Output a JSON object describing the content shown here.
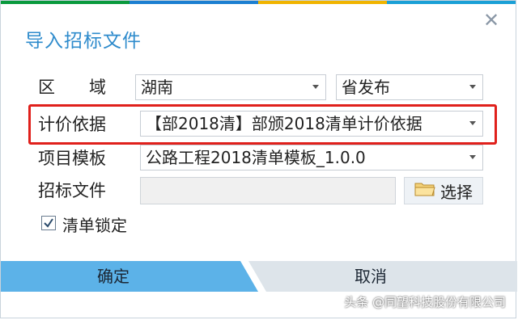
{
  "dialog": {
    "title": "导入招标文件"
  },
  "colors": {
    "top_bar": [
      "#0a9a3d",
      "#1c7fd1",
      "#f0b400",
      "#1aa0d6"
    ],
    "accent": "#2e8bcc",
    "ok_button": "#5cb2e8",
    "highlight": "#e0201b"
  },
  "form": {
    "region": {
      "label": "区　　域",
      "value": "湖南",
      "publisher": "省发布"
    },
    "pricing_basis": {
      "label": "计价依据",
      "value": "【部2018清】部颁2018清单计价依据"
    },
    "template": {
      "label": "项目模板",
      "value": "公路工程2018清单模板_1.0.0"
    },
    "bid_file": {
      "label": "招标文件",
      "value": "",
      "browse_label": "选择"
    },
    "lock_list": {
      "label": "清单锁定",
      "checked": true
    }
  },
  "buttons": {
    "ok": "确定",
    "cancel": "取消"
  },
  "watermark": "头条 @同望科技股份有限公司"
}
